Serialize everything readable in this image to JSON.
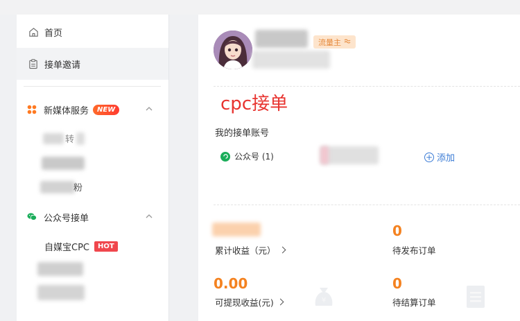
{
  "sidebar": {
    "items": [
      {
        "label": "首页",
        "icon": "home-icon"
      },
      {
        "label": "接单邀请",
        "icon": "clipboard-icon"
      }
    ],
    "groups": [
      {
        "label": "新媒体服务",
        "badge": "NEW",
        "icon": "apps-icon",
        "chevron": "chevron-up-icon"
      },
      {
        "label": "公众号接单",
        "icon": "wechat-icon",
        "chevron": "chevron-up-icon"
      }
    ],
    "sub_items_media": [
      {
        "label": "转"
      },
      {
        "label": ""
      },
      {
        "label": "粉"
      }
    ],
    "sub_items_wechat": [
      {
        "label": "自媒宝CPC",
        "badge": "HOT"
      }
    ]
  },
  "profile": {
    "tag": "流量主",
    "tag_icon": "wave-icon"
  },
  "main": {
    "heading": "cpc接单",
    "accounts_title": "我的接单账号",
    "account_type": "公众号 (1)",
    "add_label": "添加"
  },
  "stats": [
    {
      "value": "",
      "label": "累计收益（元）"
    },
    {
      "value": "0",
      "label": "待发布订单"
    },
    {
      "value": "0.00",
      "label": "可提现收益(元)"
    },
    {
      "value": "0",
      "label": "待结算订单"
    }
  ],
  "colors": {
    "accent_orange": "#f48220",
    "heading_red": "#e8332f",
    "link_blue": "#3a7bd5",
    "wechat_green": "#1aad5a"
  }
}
